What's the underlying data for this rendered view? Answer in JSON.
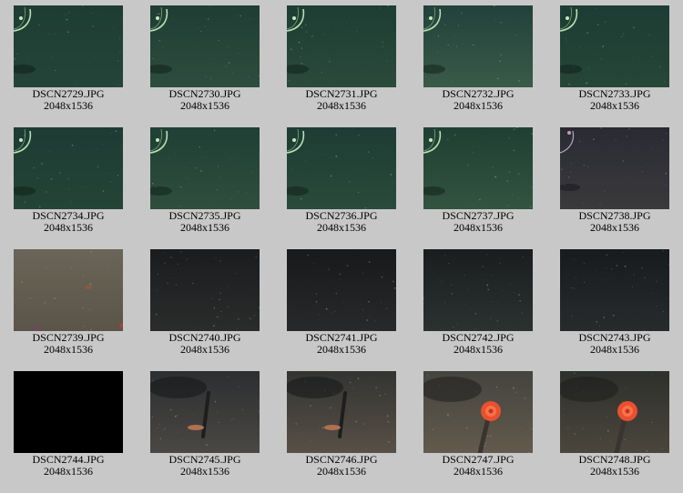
{
  "gallery": {
    "thumbnails": [
      {
        "filename": "DSCN2729.JPG",
        "dimensions": "2048x1536",
        "scene": "green-cable",
        "top": "#1e3c32",
        "bottom": "#24443a"
      },
      {
        "filename": "DSCN2730.JPG",
        "dimensions": "2048x1536",
        "scene": "green-cable",
        "top": "#1f3d33",
        "bottom": "#2e4d3f"
      },
      {
        "filename": "DSCN2731.JPG",
        "dimensions": "2048x1536",
        "scene": "green-cable",
        "top": "#1e3d33",
        "bottom": "#2b4a3c"
      },
      {
        "filename": "DSCN2732.JPG",
        "dimensions": "2048x1536",
        "scene": "green-cable",
        "top": "#22413a",
        "bottom": "#3a5a4a"
      },
      {
        "filename": "DSCN2733.JPG",
        "dimensions": "2048x1536",
        "scene": "green-cable",
        "top": "#1d3c33",
        "bottom": "#264638"
      },
      {
        "filename": "DSCN2734.JPG",
        "dimensions": "2048x1536",
        "scene": "green-cable",
        "top": "#1d3b33",
        "bottom": "#254437"
      },
      {
        "filename": "DSCN2735.JPG",
        "dimensions": "2048x1536",
        "scene": "green-cable",
        "top": "#203f35",
        "bottom": "#2f4e3e"
      },
      {
        "filename": "DSCN2736.JPG",
        "dimensions": "2048x1536",
        "scene": "green-cable",
        "top": "#1e3c33",
        "bottom": "#2a4a3b"
      },
      {
        "filename": "DSCN2737.JPG",
        "dimensions": "2048x1536",
        "scene": "green-cable",
        "top": "#1f3f33",
        "bottom": "#33543f"
      },
      {
        "filename": "DSCN2738.JPG",
        "dimensions": "2048x1536",
        "scene": "purple-haze",
        "top": "#2a2a34",
        "bottom": "#3a3a3c"
      },
      {
        "filename": "DSCN2739.JPG",
        "dimensions": "2048x1536",
        "scene": "brown-seafloor",
        "top": "#6a6558",
        "bottom": "#5c5448"
      },
      {
        "filename": "DSCN2740.JPG",
        "dimensions": "2048x1536",
        "scene": "dark",
        "top": "#1a1c1e",
        "bottom": "#2a2c2c"
      },
      {
        "filename": "DSCN2741.JPG",
        "dimensions": "2048x1536",
        "scene": "dark",
        "top": "#18191b",
        "bottom": "#28292a"
      },
      {
        "filename": "DSCN2742.JPG",
        "dimensions": "2048x1536",
        "scene": "dark",
        "top": "#1a1d1e",
        "bottom": "#2b3230"
      },
      {
        "filename": "DSCN2743.JPG",
        "dimensions": "2048x1536",
        "scene": "dark",
        "top": "#181b1e",
        "bottom": "#272b2c"
      },
      {
        "filename": "DSCN2744.JPG",
        "dimensions": "2048x1536",
        "scene": "black",
        "top": "#000000",
        "bottom": "#000000"
      },
      {
        "filename": "DSCN2745.JPG",
        "dimensions": "2048x1536",
        "scene": "probe",
        "top": "#2c2e30",
        "bottom": "#4a4844"
      },
      {
        "filename": "DSCN2746.JPG",
        "dimensions": "2048x1536",
        "scene": "probe",
        "top": "#333432",
        "bottom": "#575046"
      },
      {
        "filename": "DSCN2747.JPG",
        "dimensions": "2048x1536",
        "scene": "anemone",
        "top": "#44443e",
        "bottom": "#625a4c"
      },
      {
        "filename": "DSCN2748.JPG",
        "dimensions": "2048x1536",
        "scene": "anemone",
        "top": "#2e302c",
        "bottom": "#4a463c"
      }
    ]
  }
}
